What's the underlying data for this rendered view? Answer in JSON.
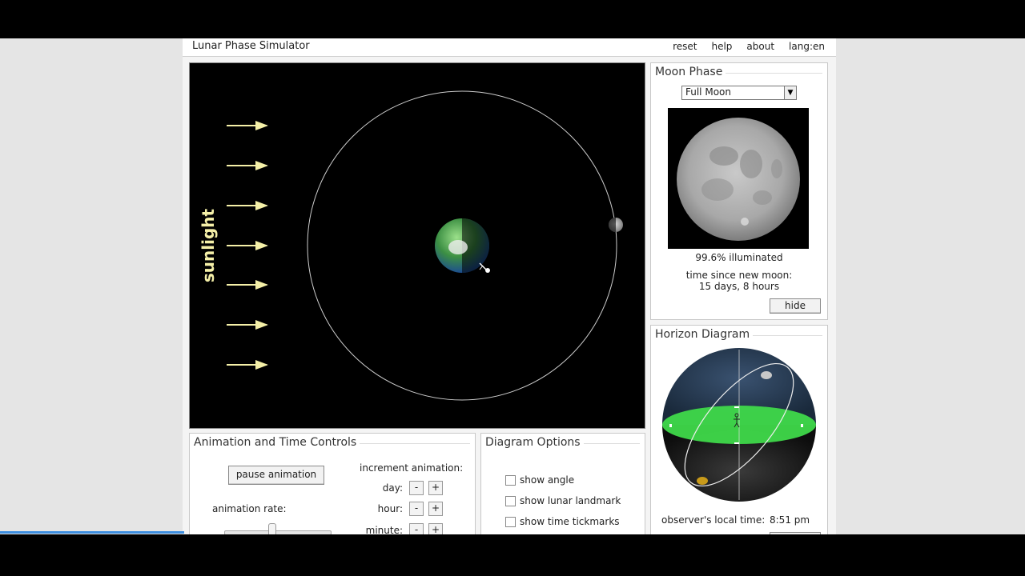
{
  "app": {
    "title": "Lunar Phase Simulator",
    "menu": [
      "reset",
      "help",
      "about",
      "lang:en"
    ]
  },
  "orbit_view": {
    "sunlight_label": "sunlight",
    "sunlight_arrow_count": 7
  },
  "moon_phase": {
    "title": "Moon Phase",
    "selected_phase": "Full Moon",
    "illuminated_text": "99.6% illuminated",
    "time_label": "time since new moon:",
    "time_value": "15 days, 8 hours",
    "hide_label": "hide"
  },
  "horizon": {
    "title": "Horizon Diagram",
    "local_time_label": "observer's local time:",
    "local_time_value": "8:51 pm"
  },
  "animation": {
    "title": "Animation and Time Controls",
    "pause_label": "pause animation",
    "rate_label": "animation rate:",
    "increment_label": "increment animation:",
    "rows": [
      {
        "label": "day:",
        "minus": "-",
        "plus": "+"
      },
      {
        "label": "hour:",
        "minus": "-",
        "plus": "+"
      },
      {
        "label": "minute:",
        "minus": "-",
        "plus": "+"
      }
    ]
  },
  "diagram_options": {
    "title": "Diagram Options",
    "options": [
      {
        "label": "show angle",
        "checked": false
      },
      {
        "label": "show lunar landmark",
        "checked": false
      },
      {
        "label": "show time tickmarks",
        "checked": false
      }
    ]
  },
  "colors": {
    "sunlight": "#f5f0a8",
    "horizon_ground": "#3fd94a",
    "sky": "#2c3e55"
  }
}
